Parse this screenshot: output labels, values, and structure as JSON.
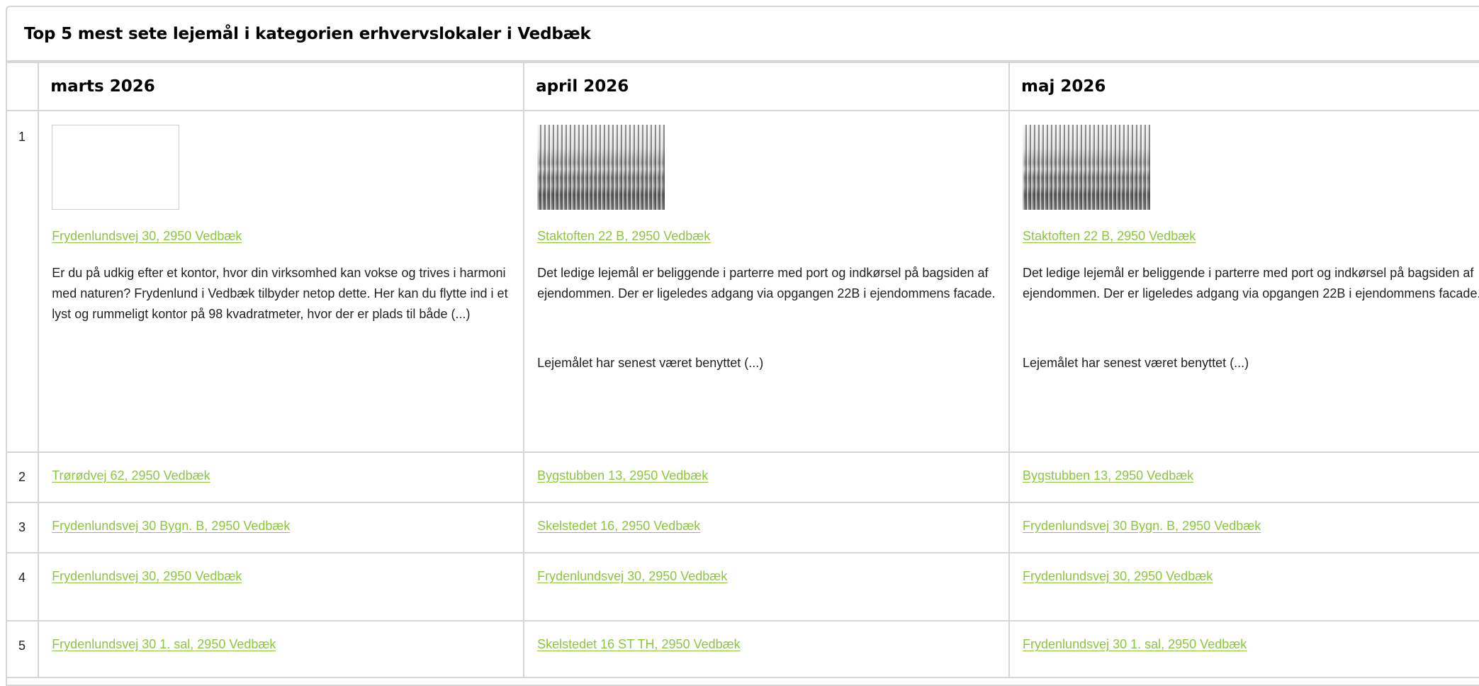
{
  "title": "Top 5 mest sete lejemål i kategorien erhvervslokaler i Vedbæk",
  "link_color": "#8cc63f",
  "columns": [
    "marts 2026",
    "april 2026",
    "maj 2026"
  ],
  "rows": [
    {
      "rank": "1",
      "cells": [
        {
          "image": "empty",
          "address": "Frydenlundsvej 30, 2950 Vedbæk",
          "description": [
            "Er du på udkig efter et kontor, hvor din virksomhed kan vokse og trives i harmoni med naturen? Frydenlund i Vedbæk tilbyder netop dette. Her kan du flytte ind i et lyst og rummeligt kontor på 98 kvadratmeter, hvor der er plads til både (...)"
          ]
        },
        {
          "image": "photo",
          "address": "Staktoften 22 B, 2950 Vedbæk",
          "description": [
            "Det ledige lejemål er beliggende i parterre med port og indkørsel på bagsiden af",
            "ejendommen. Der er ligeledes adgang via opgangen 22B i ejendommens facade.",
            "Lejemålet har senest været benyttet (...)"
          ]
        },
        {
          "image": "photo",
          "address": "Staktoften 22 B, 2950 Vedbæk",
          "description": [
            "Det ledige lejemål er beliggende i parterre med port og indkørsel på bagsiden af",
            "ejendommen. Der er ligeledes adgang via opgangen 22B i ejendommens facade.",
            "Lejemålet har senest været benyttet (...)"
          ]
        }
      ]
    },
    {
      "rank": "2",
      "cells": [
        {
          "address": "Trørødvej 62, 2950 Vedbæk"
        },
        {
          "address": "Bygstubben 13, 2950 Vedbæk"
        },
        {
          "address": "Bygstubben 13, 2950 Vedbæk"
        }
      ]
    },
    {
      "rank": "3",
      "cells": [
        {
          "address": "Frydenlundsvej 30 Bygn. B, 2950 Vedbæk"
        },
        {
          "address": "Skelstedet 16, 2950 Vedbæk"
        },
        {
          "address": "Frydenlundsvej 30 Bygn. B, 2950 Vedbæk"
        }
      ]
    },
    {
      "rank": "4",
      "cells": [
        {
          "address": "Frydenlundsvej 30, 2950 Vedbæk"
        },
        {
          "address": "Frydenlundsvej 30, 2950 Vedbæk"
        },
        {
          "address": "Frydenlundsvej 30, 2950 Vedbæk"
        }
      ]
    },
    {
      "rank": "5",
      "cells": [
        {
          "address": "Frydenlundsvej 30 1. sal, 2950 Vedbæk"
        },
        {
          "address": "Skelstedet 16 ST TH, 2950 Vedbæk"
        },
        {
          "address": "Frydenlundsvej 30 1. sal, 2950 Vedbæk"
        }
      ]
    }
  ]
}
